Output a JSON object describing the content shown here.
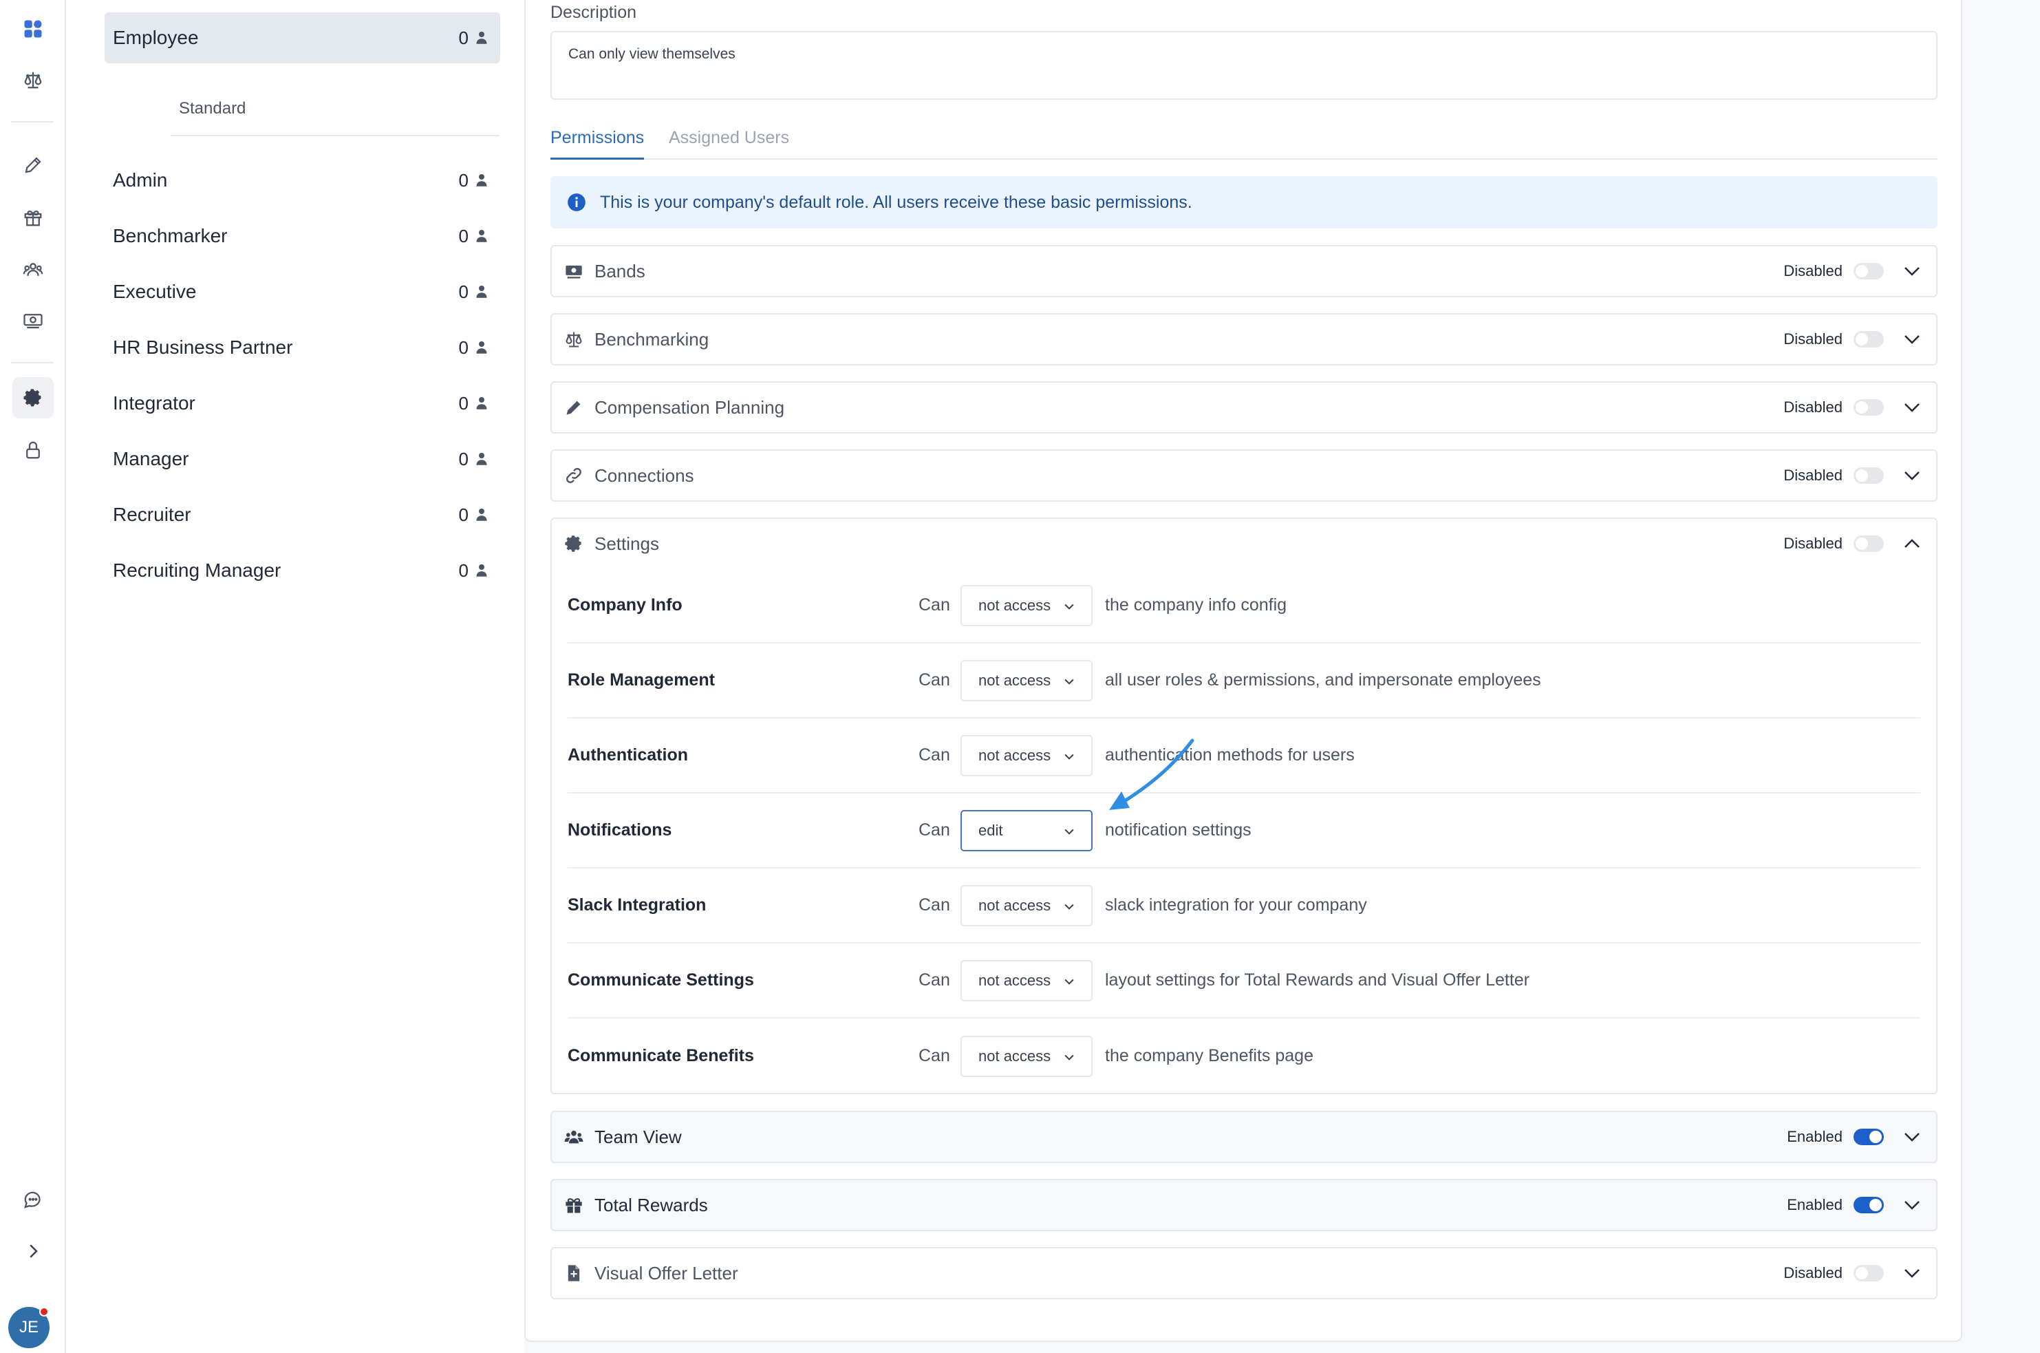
{
  "rail": {
    "icons": [
      "dashboard-icon",
      "scale-icon",
      "pencil-icon",
      "gift-icon",
      "team-icon",
      "money-icon",
      "gear-icon",
      "lock-icon",
      "chat-icon",
      "chevron-right-icon"
    ],
    "avatar_initials": "JE"
  },
  "roles": {
    "selected": {
      "name": "Employee",
      "count": "0"
    },
    "section_label": "Standard",
    "items": [
      {
        "name": "Admin",
        "count": "0"
      },
      {
        "name": "Benchmarker",
        "count": "0"
      },
      {
        "name": "Executive",
        "count": "0"
      },
      {
        "name": "HR Business Partner",
        "count": "0"
      },
      {
        "name": "Integrator",
        "count": "0"
      },
      {
        "name": "Manager",
        "count": "0"
      },
      {
        "name": "Recruiter",
        "count": "0"
      },
      {
        "name": "Recruiting Manager",
        "count": "0"
      }
    ]
  },
  "main": {
    "description_label": "Description",
    "description_value": "Can only view themselves",
    "tabs": [
      {
        "label": "Permissions"
      },
      {
        "label": "Assigned Users"
      }
    ],
    "notice": "This is your company's default role. All users receive these basic permissions.",
    "sections": [
      {
        "title": "Bands",
        "status": "Disabled",
        "icon": "money-icon"
      },
      {
        "title": "Benchmarking",
        "status": "Disabled",
        "icon": "scale-icon"
      },
      {
        "title": "Compensation Planning",
        "status": "Disabled",
        "icon": "pencil-icon"
      },
      {
        "title": "Connections",
        "status": "Disabled",
        "icon": "link-icon"
      },
      {
        "title": "Settings",
        "status": "Disabled",
        "icon": "gear-icon"
      },
      {
        "title": "Team View",
        "status": "Enabled",
        "icon": "team-icon"
      },
      {
        "title": "Total Rewards",
        "status": "Enabled",
        "icon": "gift-icon"
      },
      {
        "title": "Visual Offer Letter",
        "status": "Disabled",
        "icon": "document-icon"
      }
    ],
    "settings_permissions": [
      {
        "name": "Company Info",
        "can": "Can",
        "level": "not access",
        "desc": "the company info config"
      },
      {
        "name": "Role Management",
        "can": "Can",
        "level": "not access",
        "desc": "all user roles & permissions, and impersonate employees"
      },
      {
        "name": "Authentication",
        "can": "Can",
        "level": "not access",
        "desc": "authentication methods for users"
      },
      {
        "name": "Notifications",
        "can": "Can",
        "level": "edit",
        "desc": "notification settings"
      },
      {
        "name": "Slack Integration",
        "can": "Can",
        "level": "not access",
        "desc": "slack integration for your company"
      },
      {
        "name": "Communicate Settings",
        "can": "Can",
        "level": "not access",
        "desc": "layout settings for Total Rewards and Visual Offer Letter"
      },
      {
        "name": "Communicate Benefits",
        "can": "Can",
        "level": "not access",
        "desc": "the company Benefits page"
      }
    ]
  },
  "colors": {
    "accent": "#2b6cb0",
    "toggle_on": "#1d5fc9",
    "annotation_arrow": "#2f8de4"
  }
}
